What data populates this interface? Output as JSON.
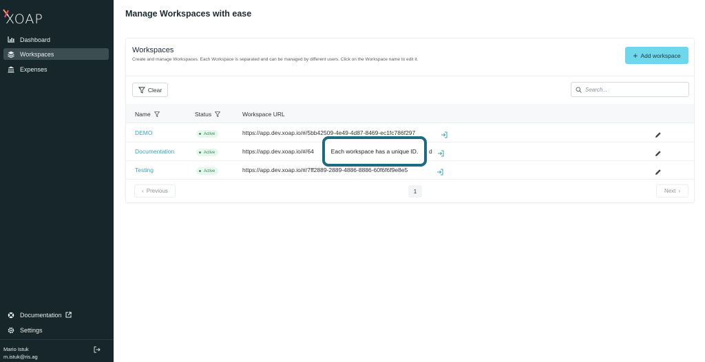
{
  "app": {
    "logo_text": "XOAP"
  },
  "sidebar": {
    "items": [
      {
        "label": "Dashboard",
        "icon": "chart-icon"
      },
      {
        "label": "Workspaces",
        "icon": "layers-icon",
        "active": true
      },
      {
        "label": "Expenses",
        "icon": "bank-icon"
      }
    ],
    "bottom": [
      {
        "label": "Documentation",
        "icon": "help-icon"
      },
      {
        "label": "Settings",
        "icon": "gear-icon"
      }
    ],
    "user": {
      "name": "Mario Istuk",
      "email": "m.istuk@ris.ag"
    }
  },
  "page": {
    "title": "Manage Workspaces with ease"
  },
  "workspaces": {
    "title": "Workspaces",
    "subtitle": "Create and manage Workspaces. Each Workspace is separated and can be managed by different users. Click on the Workspace name to edit it.",
    "add_label": "Add workspace",
    "clear_label": "Clear",
    "search_placeholder": "Search...",
    "columns": [
      "Name",
      "Status",
      "Workspace URL"
    ],
    "rows": [
      {
        "name": "DEMO",
        "status": "Active",
        "url": "https://app.dev.xoap.io/#/5bb42509-4e49-4d87-8469-ec1fc786f297"
      },
      {
        "name": "Documentation",
        "status": "Active",
        "url": "https://app.dev.xoap.io/#/64",
        "url_tail": "d"
      },
      {
        "name": "Testing",
        "status": "Active",
        "url": "https://app.dev.xoap.io/#/7ff2889-2889-4886-8886-60f6f6f9e8e5"
      }
    ],
    "pagination": {
      "prev_label": "Previous",
      "current_page": "1",
      "next_label": "Next"
    }
  },
  "tooltip": {
    "text": "Each workspace has a unique ID."
  },
  "colors": {
    "sidebar_bg": "#17262b",
    "accent": "#6fd7ea",
    "link": "#3aa5bd",
    "callout_border": "#1c6a84",
    "active_badge": "#2f8f55"
  }
}
